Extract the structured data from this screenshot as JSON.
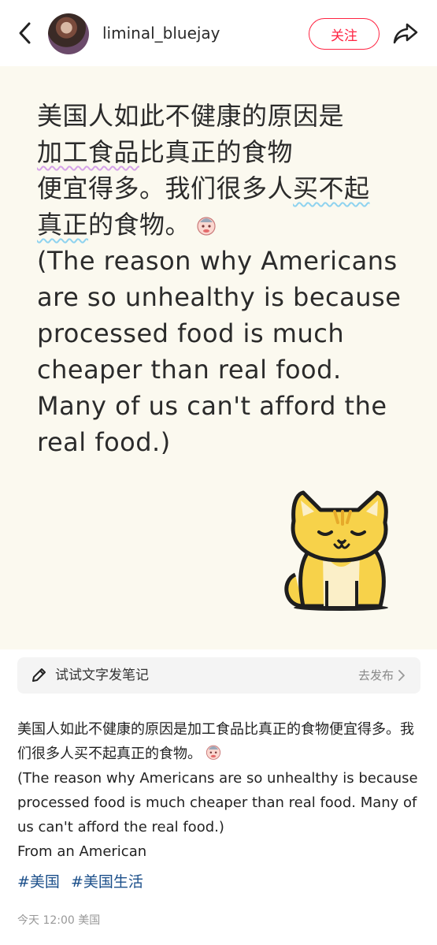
{
  "header": {
    "username": "liminal_bluejay",
    "follow_label": "关注"
  },
  "card": {
    "zh_line1": "美国人如此不健康的原因是",
    "zh_line2_underlined": "加工食品",
    "zh_line2_rest": "比真正的食物",
    "zh_line3_start": "便宜得多。我们很多人",
    "zh_line3_underlined": "买不起",
    "zh_line4_underlined": "真正",
    "zh_line4_rest": "的食物。",
    "en_line1": "(The reason why Americans",
    "en_line2": "are so unhealthy is because",
    "en_line3": "processed food is much",
    "en_line4": "cheaper than real food.",
    "en_line5": "Many of us can't afford the",
    "en_line6": "real food.)"
  },
  "try_bar": {
    "label": "试试文字发笔记",
    "publish": "去发布"
  },
  "post": {
    "zh": "美国人如此不健康的原因是加工食品比真正的食物便宜得多。我们很多人买不起真正的食物。",
    "en": "(The reason why Americans are so unhealthy is because processed food is much cheaper than real food. Many of us can't afford the real food.)",
    "signature": "From an American",
    "tags": [
      "#美国",
      "#美国生活"
    ]
  },
  "meta": {
    "time_location": "今天 12:00 美国"
  },
  "colors": {
    "accent": "#ff2442",
    "tag": "#1b4f8a",
    "card_bg": "#fbf9ef"
  }
}
